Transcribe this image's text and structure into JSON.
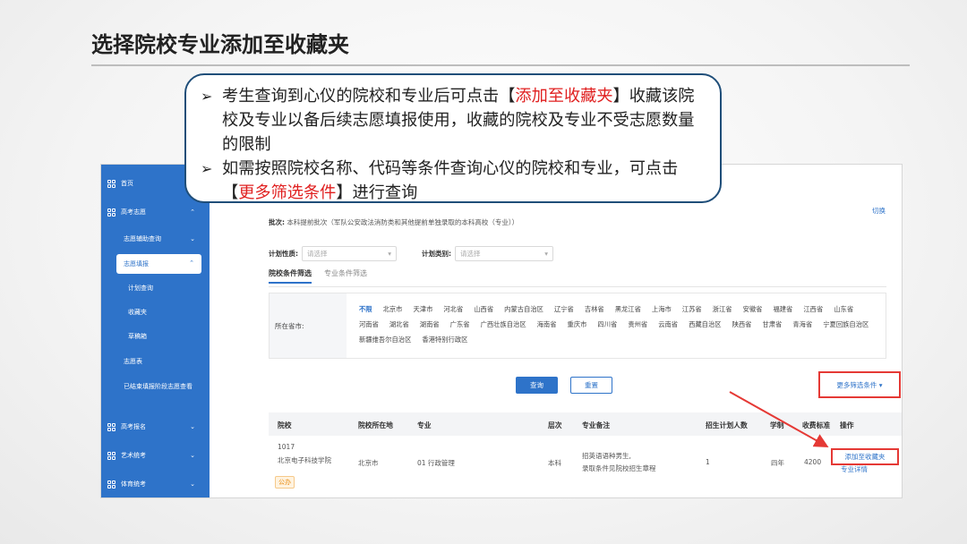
{
  "slide_title": "选择院校专业添加至收藏夹",
  "callout": {
    "b1_pre": "考生查询到心仪的院校和专业后可点击【",
    "b1_red": "添加至收藏夹",
    "b1_post": "】收藏该院校及专业以备后续志愿填报使用，收藏的院校及专业不受志愿数量的限制",
    "b2_pre": "如需按照院校名称、代码等条件查询心仪的院校和专业，可点击【",
    "b2_red": "更多筛选条件",
    "b2_post": "】进行查询"
  },
  "sidebar": {
    "home": "首页",
    "gaokao": "高考志愿",
    "aux": "志愿辅助查询",
    "fill": "志愿填报",
    "plan": "计划查询",
    "fav": "收藏夹",
    "draft": "草稿箱",
    "table": "志愿表",
    "ended": "已结束填报阶段志愿查看",
    "signup": "高考报名",
    "art": "艺术统考",
    "sport": "体育统考"
  },
  "main": {
    "switch": "切换",
    "batch_label": "批次:",
    "batch_value": "本科提前批次（军队公安政法消防类和其他提前单独录取的本科高校（专业））",
    "plan_nature_label": "计划性质:",
    "plan_type_label": "计划类别:",
    "select_placeholder": "请选择",
    "tab_school": "院校条件筛选",
    "tab_major": "专业条件筛选",
    "region_label": "所在省市:",
    "regions": [
      "不限",
      "北京市",
      "天津市",
      "河北省",
      "山西省",
      "内蒙古自治区",
      "辽宁省",
      "吉林省",
      "黑龙江省",
      "上海市",
      "江苏省",
      "浙江省",
      "安徽省",
      "福建省",
      "江西省",
      "山东省",
      "河南省",
      "湖北省",
      "湖南省",
      "广东省",
      "广西壮族自治区",
      "海南省",
      "重庆市",
      "四川省",
      "贵州省",
      "云南省",
      "西藏自治区",
      "陕西省",
      "甘肃省",
      "青海省",
      "宁夏回族自治区",
      "新疆维吾尔自治区",
      "香港特别行政区"
    ],
    "btn_query": "查询",
    "btn_reset": "重置",
    "more_filter": "更多筛选条件 ▾"
  },
  "table": {
    "headers": {
      "school": "院校",
      "location": "院校所在地",
      "major": "专业",
      "level": "层次",
      "note": "专业备注",
      "plan": "招生计划人数",
      "years": "学制",
      "fee": "收费标准",
      "op": "操作"
    },
    "row": {
      "code": "1017",
      "name": "北京电子科技学院",
      "tag": "公办",
      "location": "北京市",
      "major": "01 行政管理",
      "level": "本科",
      "note1": "招英语语种男生,",
      "note2": "录取条件见院校招生章程",
      "plan": "1",
      "years": "四年",
      "fee": "4200",
      "add": "添加至收藏夹",
      "detail": "专业详情"
    }
  }
}
